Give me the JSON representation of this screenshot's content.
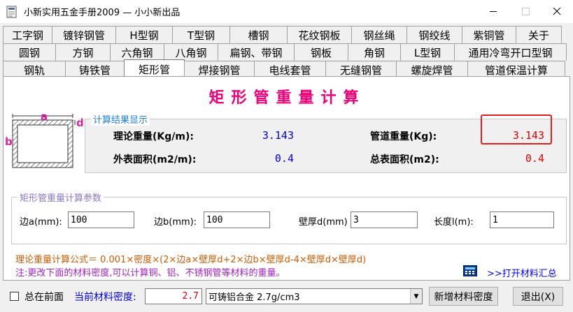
{
  "window": {
    "title": "小新实用五金手册2009 — 小小新出品",
    "minimize_icon": "minimize-icon",
    "maximize_icon": "maximize-icon",
    "close_icon": "close-icon"
  },
  "tabs": {
    "row1": [
      "工字钢",
      "镀锌钢管",
      "H型钢",
      "T型钢",
      "槽钢",
      "花纹钢板",
      "钢丝绳",
      "钢绞线",
      "紫铜管",
      "关于"
    ],
    "row2": [
      "圆钢",
      "方钢",
      "六角钢",
      "八角钢",
      "扁钢、带钢",
      "钢板",
      "角钢",
      "L型钢",
      "通用冷弯开口型钢"
    ],
    "row3": [
      "钢轨",
      "铸铁管",
      "矩形管",
      "焊接钢管",
      "电线套管",
      "无缝钢管",
      "螺旋焊管",
      "管道保温计算"
    ],
    "active": "矩形管"
  },
  "page": {
    "title": "矩形管重量计算"
  },
  "diagram": {
    "label_a": "a",
    "label_b": "b",
    "label_d": "d"
  },
  "results": {
    "legend": "计算结果显示",
    "theory_weight_label": "理论重量(Kg/m):",
    "theory_weight_value": "3.143",
    "pipe_weight_label": "管道重量(Kg):",
    "pipe_weight_value": "3.143",
    "outer_area_label": "外表面积(m2/m):",
    "outer_area_value": "0.4",
    "total_area_label": "总表面积(m2):",
    "total_area_value": "0.4"
  },
  "params": {
    "legend": "矩形管重量计算参数",
    "side_a_label": "边a(mm):",
    "side_a_value": "100",
    "side_b_label": "边b(mm):",
    "side_b_value": "100",
    "thickness_label": "壁厚d(mm)",
    "thickness_value": "3",
    "length_label": "长度l(m):",
    "length_value": "1"
  },
  "formula": {
    "text": "理论重量计算公式＝ 0.001×密度×(2×边a×壁厚d+2×边b×壁厚d-4×壁厚d×壁厚d)",
    "note": "注:更改下面的材料密度,可以计算铜、铝、不锈钢管等材料的重量。",
    "open_materials": ">>打开材料汇总"
  },
  "bottom": {
    "always_on_top_label": "总在前面",
    "density_label": "当前材料密度:",
    "density_value": "2.7",
    "material_select": "可铸铝合金 2.7g/cm3",
    "add_density_button": "新增材料密度",
    "exit_button": "退出(X)"
  },
  "colors": {
    "title_pink": "#f00078",
    "value_blue": "#0000e0",
    "value_red": "#e00000",
    "legend_blue": "#1c7fe0",
    "formula_orange": "#d05a00",
    "note_purple": "#a020c0"
  }
}
